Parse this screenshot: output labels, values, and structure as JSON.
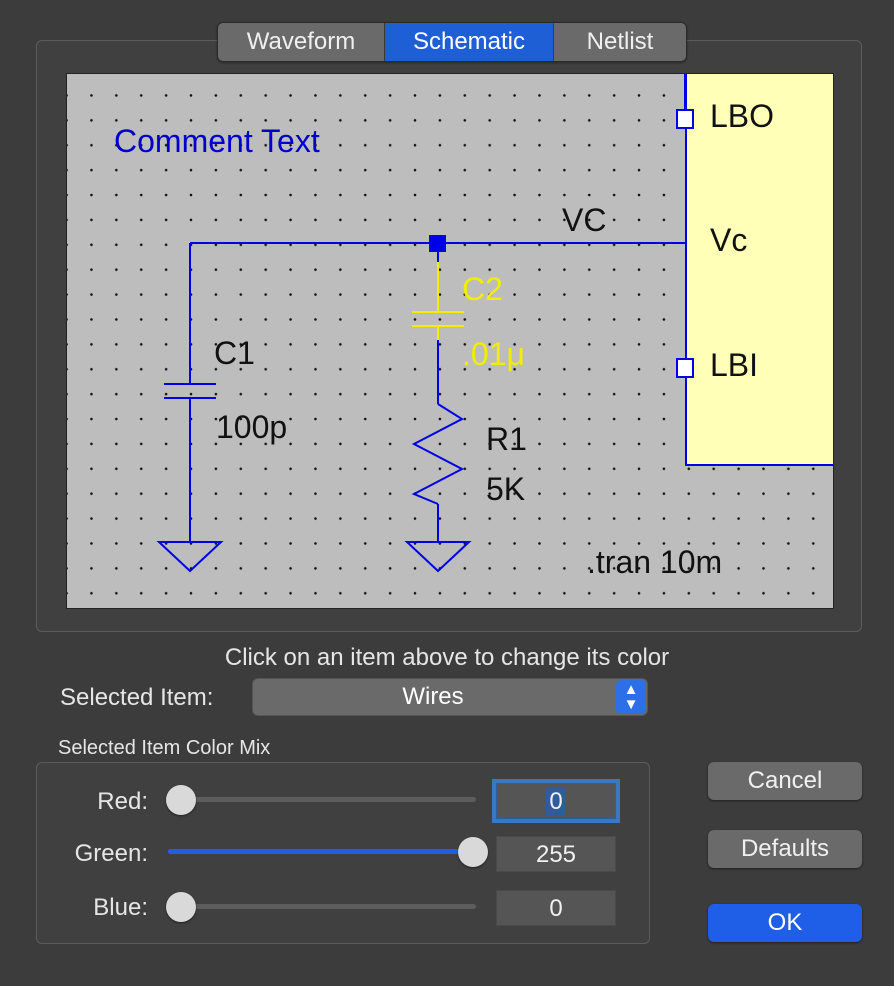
{
  "tabs": [
    {
      "label": "Waveform",
      "active": false
    },
    {
      "label": "Schematic",
      "active": true
    },
    {
      "label": "Netlist",
      "active": false
    }
  ],
  "schematic": {
    "comment_text": "Comment Text",
    "net_label": "VC",
    "ic_pins": {
      "lbo": "LBO",
      "vc": "Vc",
      "lbi": "LBI"
    },
    "c1": {
      "name": "C1",
      "value": "100p"
    },
    "c2": {
      "name": "C2",
      "value": ".01μ"
    },
    "r1": {
      "name": "R1",
      "value": "5K"
    },
    "directive": ".tran 10m",
    "colors": {
      "background": "#bdbdbd",
      "wires": "#0000e8",
      "component_label": "#111111",
      "selected_component": "#f2ee00",
      "comment": "#0000cc",
      "ic_fill": "#ffffb8"
    }
  },
  "hint": "Click on an item above to change its color",
  "selected_item": {
    "label": "Selected Item:",
    "value": "Wires"
  },
  "color_mix": {
    "title": "Selected Item Color Mix",
    "red": {
      "label": "Red:",
      "value": "0",
      "level": 0
    },
    "green": {
      "label": "Green:",
      "value": "255",
      "level": 1
    },
    "blue": {
      "label": "Blue:",
      "value": "0",
      "level": 0
    }
  },
  "buttons": {
    "cancel": "Cancel",
    "defaults": "Defaults",
    "ok": "OK"
  }
}
